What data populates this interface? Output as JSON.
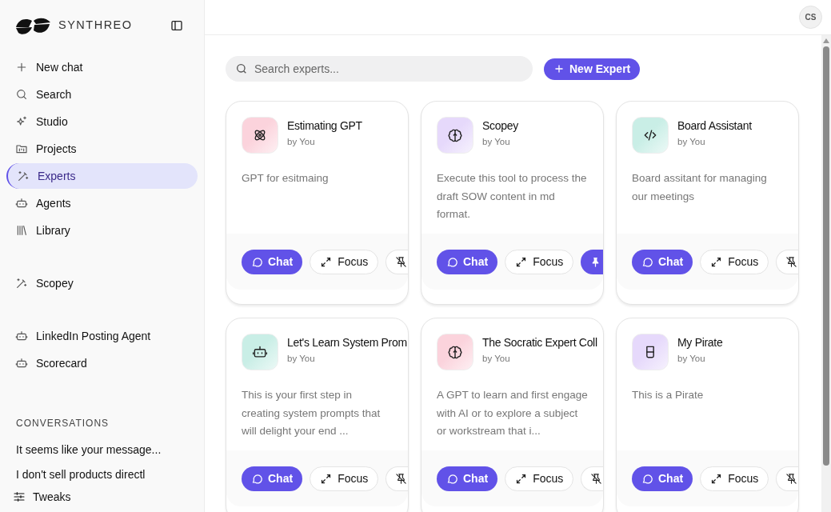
{
  "sidebar": {
    "brand": "SYNTHREO",
    "nav": [
      {
        "label": "New chat",
        "kind": "plus",
        "selected": false
      },
      {
        "label": "Search",
        "kind": "search",
        "selected": false
      },
      {
        "label": "Studio",
        "kind": "sparkle",
        "selected": false
      },
      {
        "label": "Projects",
        "kind": "folder",
        "selected": false
      },
      {
        "label": "Experts",
        "kind": "wand",
        "selected": true
      },
      {
        "label": "Agents",
        "kind": "robot",
        "selected": false
      },
      {
        "label": "Library",
        "kind": "library",
        "selected": false
      }
    ],
    "pinned_experts": [
      {
        "label": "Scopey",
        "kind": "wand"
      }
    ],
    "pinned_agents": [
      {
        "label": "LinkedIn Posting Agent",
        "kind": "robot"
      },
      {
        "label": "Scorecard",
        "kind": "robot"
      }
    ],
    "conversations_heading": "CONVERSATIONS",
    "conversations": [
      "It seems like your message...",
      "I don't sell products directl"
    ],
    "footer": "Tweaks"
  },
  "header": {
    "avatar": "CS"
  },
  "toolbar": {
    "search": {
      "placeholder": "Search experts..."
    },
    "new_button": "New Expert"
  },
  "experts": [
    {
      "title": "Estimating GPT",
      "author": "by You",
      "description": "GPT for esitmaing",
      "kind": "atom",
      "color": "#fbd3dc",
      "pinned": false,
      "actions": [
        "Chat",
        "Focus"
      ]
    },
    {
      "title": "Scopey",
      "author": "by You",
      "description": "Execute this tool to process the draft SOW content in md format.",
      "kind": "brain",
      "color": "#e6d9fb",
      "pinned": true,
      "actions": [
        "Chat",
        "Focus"
      ]
    },
    {
      "title": "Board Assistant",
      "author": "by You",
      "description": "Board assitant for managing our meetings",
      "kind": "code",
      "color": "#c9eee6",
      "pinned": false,
      "actions": [
        "Chat",
        "Focus"
      ]
    },
    {
      "title": "Let's Learn System Prom",
      "author": "by You",
      "description": "This is your first step in creating system prompts that will delight your end ...",
      "kind": "robot",
      "color": "#c9eee6",
      "pinned": false,
      "actions": [
        "Chat",
        "Focus"
      ]
    },
    {
      "title": "The Socratic Expert Coll",
      "author": "by You",
      "description": "A GPT to learn and first engage with AI or to explore a subject or workstream that i...",
      "kind": "brain",
      "color": "#fbd3dc",
      "pinned": false,
      "actions": [
        "Chat",
        "Focus"
      ]
    },
    {
      "title": "My Pirate",
      "author": "by You",
      "description": "This is a Pirate",
      "kind": "cup",
      "color": "#e6d9fb",
      "pinned": false,
      "actions": [
        "Chat",
        "Focus"
      ]
    }
  ]
}
